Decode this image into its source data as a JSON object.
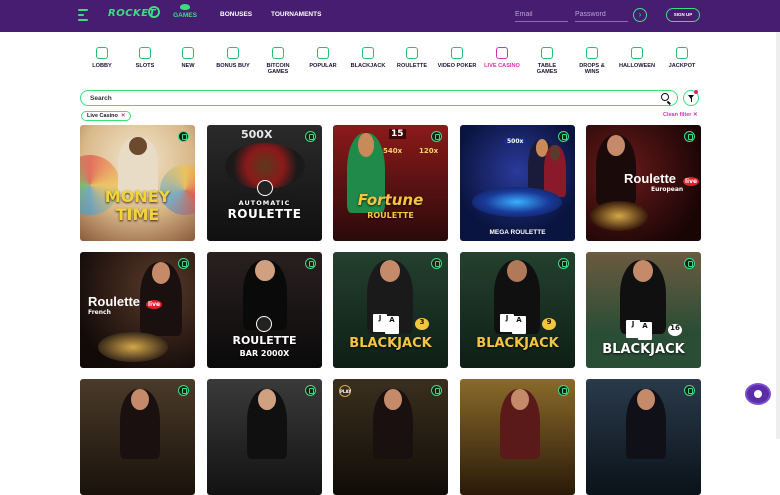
{
  "header": {
    "logo": "ROCKET",
    "nav": {
      "games": "GAMES",
      "bonuses": "BONUSES",
      "tournaments": "TOURNAMENTS"
    },
    "email_placeholder": "Email",
    "password_placeholder": "Password",
    "go_glyph": "›",
    "signup": "SIGN UP"
  },
  "categories": [
    {
      "label": "LOBBY",
      "icon": "seven-icon"
    },
    {
      "label": "SLOTS",
      "icon": "seven-icon"
    },
    {
      "label": "NEW",
      "icon": "monitor-icon"
    },
    {
      "label": "BONUS BUY",
      "icon": "gift-icon"
    },
    {
      "label": "BITCOIN GAMES",
      "icon": "bitcoin-icon"
    },
    {
      "label": "POPULAR",
      "icon": "flame-icon"
    },
    {
      "label": "BLACKJACK",
      "icon": "club-icon"
    },
    {
      "label": "ROULETTE",
      "icon": "roulette-icon"
    },
    {
      "label": "VIDEO POKER",
      "icon": "play-icon"
    },
    {
      "label": "LIVE CASINO",
      "icon": "live-icon",
      "active": true
    },
    {
      "label": "TABLE GAMES",
      "icon": "table-icon"
    },
    {
      "label": "DROPS & WINS",
      "icon": "drops-icon"
    },
    {
      "label": "HALLOWEEN",
      "icon": "pumpkin-icon"
    },
    {
      "label": "JACKPOT",
      "icon": "confetti-icon"
    }
  ],
  "search": {
    "placeholder": "Search"
  },
  "filter": {
    "chip": "Live Casino",
    "chip_close": "✕",
    "clean": "Clean filter ✕"
  },
  "games": [
    {
      "title": "MONEY",
      "title2": "TIME",
      "bg": "#d9c8a8"
    },
    {
      "title": "AUTOMATIC",
      "title2": "ROULETTE",
      "top": "500X",
      "bg": "#1f1f1f"
    },
    {
      "title": "Fortune",
      "title2": "ROULETTE",
      "top": "15",
      "top2": "540x",
      "top3": "120x",
      "bg": "#7a1818"
    },
    {
      "title": "MEGA ROULETTE",
      "top": "500x",
      "bg": "#0d1a4a"
    },
    {
      "title": "Roulette",
      "title2": "European",
      "live": "live",
      "bg": "#3a0f10"
    },
    {
      "title": "Roulette",
      "title2": "French",
      "live": "live",
      "bg": "#2a1e1a"
    },
    {
      "title": "ROULETTE",
      "title2": "BAR 2000X",
      "bg": "#121212"
    },
    {
      "title": "BLACKJACK",
      "card": "3",
      "bg": "#1b3d2a"
    },
    {
      "title": "BLACKJACK",
      "card": "9",
      "bg": "#1b3d2a"
    },
    {
      "title": "BLACKJACK",
      "card": "16",
      "bg": "#2a4d35"
    },
    {
      "bg": "#4a3a2a"
    },
    {
      "bg": "#2c2c2c"
    },
    {
      "badge": "PLAY",
      "bg": "#2a2318"
    },
    {
      "bg": "#7a5a1a"
    },
    {
      "bg": "#1f2a3a"
    }
  ]
}
